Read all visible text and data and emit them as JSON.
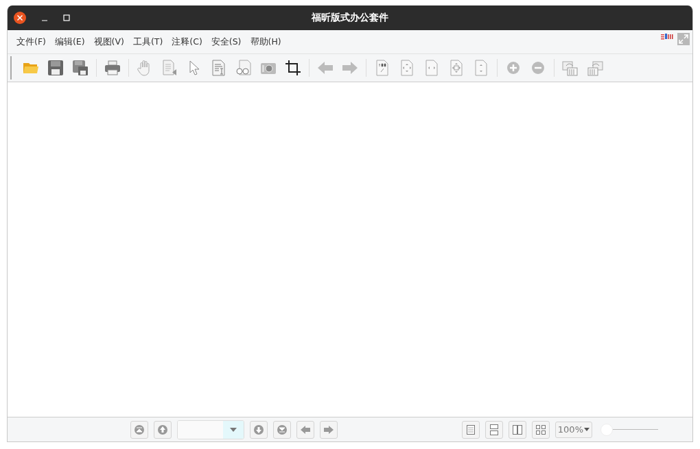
{
  "window": {
    "title": "福昕版式办公套件"
  },
  "menu": [
    {
      "label": "文件(F)"
    },
    {
      "label": "编辑(E)"
    },
    {
      "label": "视图(V)"
    },
    {
      "label": "工具(T)"
    },
    {
      "label": "注释(C)"
    },
    {
      "label": "安全(S)"
    },
    {
      "label": "帮助(H)"
    }
  ],
  "toolbar": [
    {
      "kind": "open"
    },
    {
      "kind": "save"
    },
    {
      "kind": "save-as"
    },
    {
      "kind": "separator"
    },
    {
      "kind": "print"
    },
    {
      "kind": "separator"
    },
    {
      "kind": "hand"
    },
    {
      "kind": "select-page"
    },
    {
      "kind": "pointer"
    },
    {
      "kind": "text-select"
    },
    {
      "kind": "glasses"
    },
    {
      "kind": "camera"
    },
    {
      "kind": "crop"
    },
    {
      "kind": "separator"
    },
    {
      "kind": "back"
    },
    {
      "kind": "forward"
    },
    {
      "kind": "separator"
    },
    {
      "kind": "actual-size"
    },
    {
      "kind": "fit-page"
    },
    {
      "kind": "fit-width"
    },
    {
      "kind": "fit-visible"
    },
    {
      "kind": "fit-height"
    },
    {
      "kind": "separator"
    },
    {
      "kind": "zoom-in"
    },
    {
      "kind": "zoom-out"
    },
    {
      "kind": "separator"
    },
    {
      "kind": "rotate-right"
    },
    {
      "kind": "rotate-left"
    }
  ],
  "bottom_bar": {
    "nav": [
      {
        "kind": "first"
      },
      {
        "kind": "prev"
      },
      {
        "kind": "page-field"
      },
      {
        "kind": "next"
      },
      {
        "kind": "last"
      },
      {
        "kind": "back"
      },
      {
        "kind": "forward"
      }
    ],
    "views": [
      {
        "kind": "single"
      },
      {
        "kind": "continuous"
      },
      {
        "kind": "facing"
      },
      {
        "kind": "facing-continuous"
      }
    ],
    "zoom": "100%",
    "zoom_slider": {
      "level": 0
    }
  }
}
